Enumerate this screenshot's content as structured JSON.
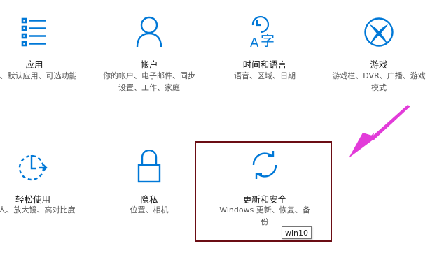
{
  "tiles": {
    "apps": {
      "title": "应用",
      "desc": [
        "戚、默认应用、可选功能"
      ]
    },
    "accounts": {
      "title": "帐户",
      "desc": [
        "你的帐户、电子邮件、同步",
        "设置、工作、家庭"
      ]
    },
    "time_language": {
      "title": "时间和语言",
      "desc": [
        "语音、区域、日期"
      ]
    },
    "gaming": {
      "title": "游戏",
      "desc": [
        "游戏栏、DVR、广播、游戏",
        "模式"
      ]
    },
    "ease_of_access": {
      "title": "轻松使用",
      "desc": [
        "述人、放大镜、高对比度"
      ]
    },
    "privacy": {
      "title": "隐私",
      "desc": [
        "位置、相机"
      ]
    },
    "update_security": {
      "title": "更新和安全",
      "desc": [
        "Windows 更新、恢复、备",
        "份"
      ]
    }
  },
  "tooltip": "win10",
  "colors": {
    "accent": "#0078d7",
    "highlight_border": "#6b0d14",
    "arrow": "#e23bd9"
  }
}
